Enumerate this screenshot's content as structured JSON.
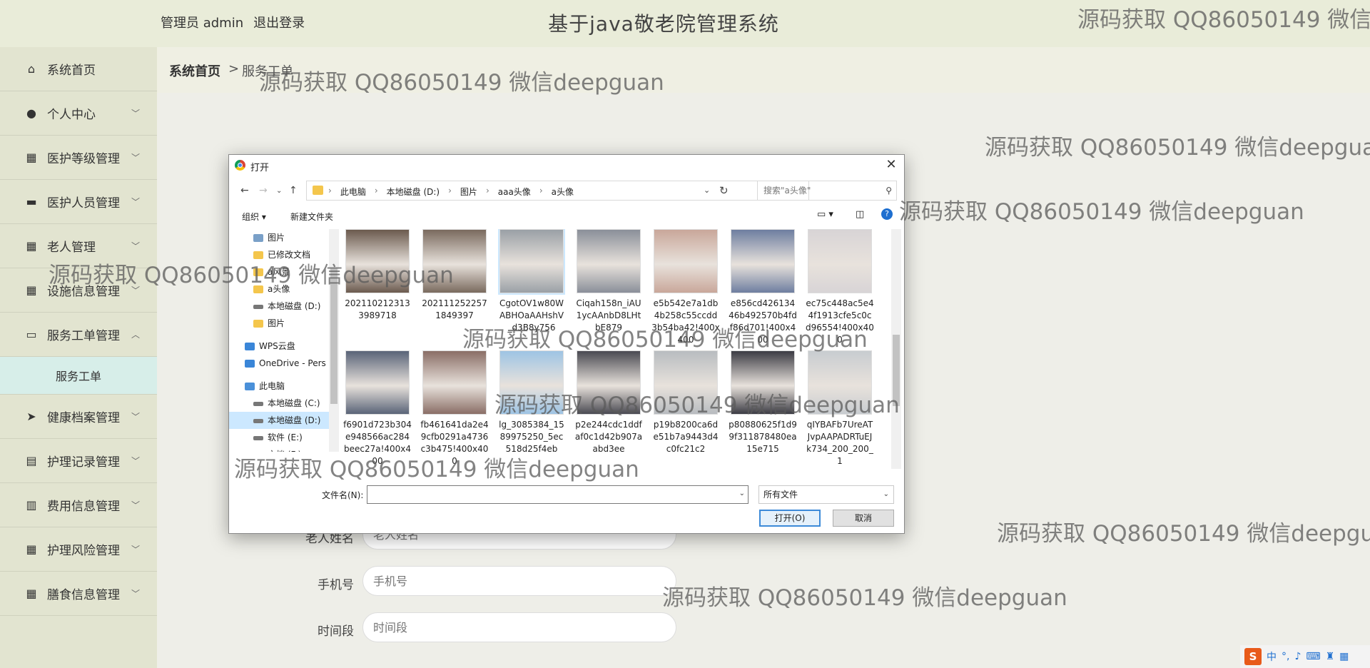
{
  "header": {
    "user_label": "管理员 admin",
    "logout_label": "退出登录",
    "title": "基于java敬老院管理系统"
  },
  "sidebar": {
    "items": [
      {
        "label": "系统首页",
        "icon": "home-icon"
      },
      {
        "label": "个人中心",
        "icon": "user-icon"
      },
      {
        "label": "医护等级管理",
        "icon": "grid-icon"
      },
      {
        "label": "医护人员管理",
        "icon": "chat-icon"
      },
      {
        "label": "老人管理",
        "icon": "grid-icon"
      },
      {
        "label": "设施信息管理",
        "icon": "grid-icon"
      },
      {
        "label": "服务工单管理",
        "icon": "monitor-icon"
      },
      {
        "label": "健康档案管理",
        "icon": "send-icon"
      },
      {
        "label": "护理记录管理",
        "icon": "chart-icon"
      },
      {
        "label": "费用信息管理",
        "icon": "bars-icon"
      },
      {
        "label": "护理风险管理",
        "icon": "grid-icon"
      },
      {
        "label": "膳食信息管理",
        "icon": "grid-icon"
      }
    ],
    "sub_item": "服务工单"
  },
  "breadcrumb": {
    "home": "系统首页",
    "separator": ">",
    "current": "服务工单"
  },
  "form": {
    "elder_name": {
      "label": "老人姓名",
      "placeholder": "老人姓名"
    },
    "phone": {
      "label": "手机号",
      "placeholder": "手机号"
    },
    "time_slot": {
      "label": "时间段",
      "placeholder": "时间段"
    }
  },
  "dialog": {
    "title": "打开",
    "close": "✕",
    "path": [
      "此电脑",
      "本地磁盘 (D:)",
      "图片",
      "aaa头像",
      "a头像"
    ],
    "search_placeholder": "搜索\"a头像\"",
    "organize": "组织 ▾",
    "new_folder": "新建文件夹",
    "nav": [
      {
        "label": "图片",
        "icon": "pictures-icon"
      },
      {
        "label": "已修改文档",
        "icon": "folder-icon"
      },
      {
        "label": "a风景",
        "icon": "folder-icon"
      },
      {
        "label": "a头像",
        "icon": "folder-icon"
      },
      {
        "label": "本地磁盘 (D:)",
        "icon": "drive-icon"
      },
      {
        "label": "图片",
        "icon": "folder-icon"
      },
      {
        "label": "WPS云盘",
        "icon": "cloud-icon"
      },
      {
        "label": "OneDrive - Pers",
        "icon": "cloud-icon"
      },
      {
        "label": "此电脑",
        "icon": "computer-icon"
      },
      {
        "label": "本地磁盘 (C:)",
        "icon": "drive-icon"
      },
      {
        "label": "本地磁盘 (D:)",
        "icon": "drive-icon"
      },
      {
        "label": "软件 (E:)",
        "icon": "drive-icon"
      },
      {
        "label": "文档 (F:)",
        "icon": "drive-icon"
      }
    ],
    "files_row1": [
      {
        "name": "2021102123133989718",
        "color": "#6b5a4e"
      },
      {
        "name": "2021112522571849397",
        "color": "#7a6a5e"
      },
      {
        "name": "CgotOV1w80WABHOaAAHshV_d3B8y756",
        "color": "#9aa0a6"
      },
      {
        "name": "Ciqah158n_iAU1ycAAnbD8LHtbE879",
        "color": "#8a8f99"
      },
      {
        "name": "e5b542e7a1db4b258c55ccdd3b54ba42!400x400",
        "color": "#c9a79a"
      },
      {
        "name": "e856cd42613446b492570b4fdf86d701!400x400",
        "color": "#6e7ea0"
      },
      {
        "name": "ec75c448ac5e44f1913cfe5c0cd96554!400x400",
        "color": "#d8d4d6"
      }
    ],
    "files_row2": [
      {
        "name": "f6901d723b304e948566ac284beec27a!400x400",
        "color": "#5a6478"
      },
      {
        "name": "fb461641da2e49cfb0291a4736c3b475!400x400",
        "color": "#8a6e66"
      },
      {
        "name": "lg_3085384_1589975250_5ec518d25f4eb",
        "color": "#9ec4e4"
      },
      {
        "name": "p2e244cdc1ddfaf0c1d42b907aabd3ee",
        "color": "#4a4a52"
      },
      {
        "name": "p19b8200ca6de51b7a9443d4c0fc21c2",
        "color": "#b8bcc0"
      },
      {
        "name": "p80880625f1d99f311878480ea15e715",
        "color": "#3c3c44"
      },
      {
        "name": "qIYBAFb7UreATJvpAAPADRTuEJk734_200_200_1",
        "color": "#c8ccd0"
      }
    ],
    "filename_label": "文件名(N):",
    "filetype": "所有文件",
    "open_button": "打开(O)",
    "cancel_button": "取消"
  },
  "watermark": "源码获取 QQ86050149 微信deepguan"
}
